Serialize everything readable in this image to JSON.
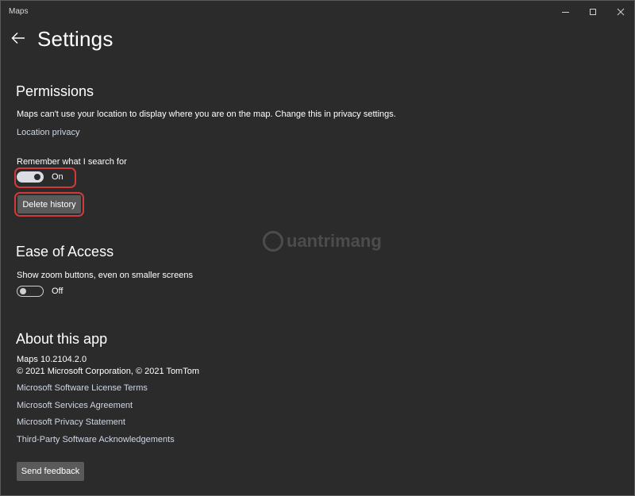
{
  "window": {
    "app_title": "Maps"
  },
  "header": {
    "title": "Settings"
  },
  "permissions": {
    "heading": "Permissions",
    "location_message": "Maps can't use your location to display where you are on the map. Change this in privacy settings.",
    "location_link": "Location privacy",
    "remember_label": "Remember what I search for",
    "remember_toggle_state": "On",
    "delete_history_button": "Delete history"
  },
  "ease_of_access": {
    "heading": "Ease of Access",
    "zoom_label": "Show zoom buttons, even on smaller screens",
    "zoom_toggle_state": "Off"
  },
  "about": {
    "heading": "About this app",
    "version": "Maps 10.2104.2.0",
    "copyright": "© 2021 Microsoft Corporation, © 2021 TomTom",
    "links": [
      "Microsoft Software License Terms",
      "Microsoft Services Agreement",
      "Microsoft Privacy Statement",
      "Third-Party Software Acknowledgements"
    ],
    "feedback_button": "Send feedback"
  },
  "watermark": {
    "text": "uantrimang"
  },
  "colors": {
    "highlight": "#d13a3a",
    "background": "#2b2b2b",
    "button": "#5a5a5a"
  }
}
